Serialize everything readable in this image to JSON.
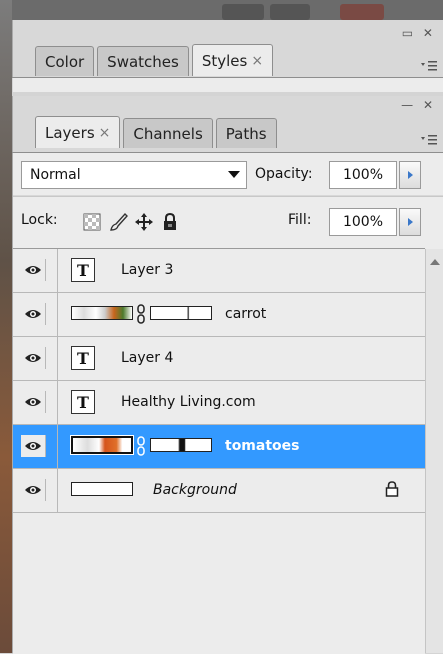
{
  "panel1": {
    "tabs": [
      {
        "label": "Color"
      },
      {
        "label": "Swatches"
      },
      {
        "label": "Styles",
        "close": "×"
      }
    ],
    "controls": "▭ ✕"
  },
  "panel2": {
    "tabs": [
      {
        "label": "Layers",
        "close": "×"
      },
      {
        "label": "Channels"
      },
      {
        "label": "Paths"
      }
    ],
    "controls": "— ✕",
    "blend_mode": "Normal",
    "opacity_label": "Opacity:",
    "opacity_value": "100%",
    "lock_label": "Lock:",
    "fill_label": "Fill:",
    "fill_value": "100%"
  },
  "layers": [
    {
      "name": "Layer 3",
      "kind": "text",
      "visible": true
    },
    {
      "name": "carrot",
      "kind": "masked-image",
      "visible": true
    },
    {
      "name": "Layer 4",
      "kind": "text",
      "visible": true
    },
    {
      "name": "Healthy Living.com",
      "kind": "text",
      "visible": true
    },
    {
      "name": "tomatoes",
      "kind": "masked-image",
      "visible": true,
      "selected": true
    },
    {
      "name": "Background",
      "kind": "background",
      "visible": true,
      "locked": true
    }
  ],
  "colors": {
    "selection": "#3399ff",
    "panel_bg": "#ececec",
    "arrow": "#3b78c9"
  }
}
